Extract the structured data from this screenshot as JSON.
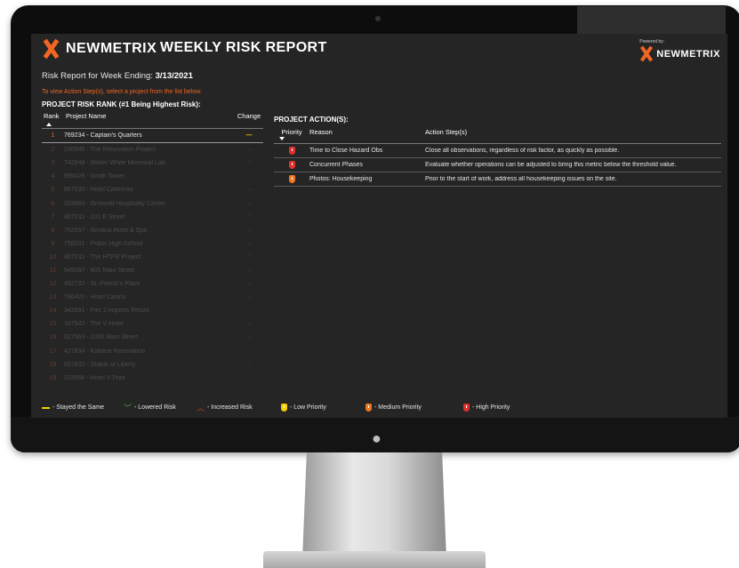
{
  "header": {
    "brand": "NEWMETRIX",
    "title": "WEEKLY RISK REPORT",
    "powered_by_label": "Powered by:",
    "powered_by_brand": "NEWMETRIX"
  },
  "week": {
    "label": "Risk Report for Week Ending:",
    "date": "3/13/2021"
  },
  "instruction": "To view Action Step(s), select a project from the list below:",
  "rank_section": {
    "title": "PROJECT RISK RANK (#1 Being Highest Risk):",
    "columns": {
      "rank": "Rank",
      "project": "Project Name",
      "change": "Change"
    },
    "rows": [
      {
        "rank": "1",
        "project": "769234 - Captain's Quarters",
        "change": "same",
        "glyph": "—",
        "selected": true
      },
      {
        "rank": "2",
        "project": "230945 - The Renovation Project",
        "change": "same",
        "glyph": "—"
      },
      {
        "rank": "3",
        "project": "742948 - Walter White Memorial Lab",
        "change": "lower",
        "glyph": "﹀"
      },
      {
        "rank": "4",
        "project": "985428 - Smith Tower",
        "change": "higher",
        "glyph": "︿"
      },
      {
        "rank": "5",
        "project": "867530 - Hotel California",
        "change": "same",
        "glyph": "—"
      },
      {
        "rank": "6",
        "project": "329864 - Griswold Hospitality Center",
        "change": "same",
        "glyph": "—"
      },
      {
        "rank": "7",
        "project": "867531 - 101 E Street",
        "change": "lower",
        "glyph": "﹀"
      },
      {
        "rank": "8",
        "project": "762957 - Nirvana Hotel & Spa",
        "change": "same",
        "glyph": "—"
      },
      {
        "rank": "9",
        "project": "758201 - Public High School",
        "change": "same",
        "glyph": "—"
      },
      {
        "rank": "10",
        "project": "867531 - The HTPR Project",
        "change": "lower",
        "glyph": "﹀"
      },
      {
        "rank": "11",
        "project": "549287 - 805 Main Street",
        "change": "same",
        "glyph": "—"
      },
      {
        "rank": "12",
        "project": "492732 - St. Patrick's Place",
        "change": "same",
        "glyph": "—"
      },
      {
        "rank": "13",
        "project": "786420 - Hotel Casino",
        "change": "same",
        "glyph": "—"
      },
      {
        "rank": "14",
        "project": "342691 - Pier 2 Imports Resort",
        "change": "higher",
        "glyph": "︿"
      },
      {
        "rank": "15",
        "project": "187542 - The V Hotel",
        "change": "same",
        "glyph": "—"
      },
      {
        "rank": "16",
        "project": "627563 - 1000 Main Street",
        "change": "same",
        "glyph": "—"
      },
      {
        "rank": "17",
        "project": "427834 - Kobane Renovation",
        "change": "higher",
        "glyph": "︿"
      },
      {
        "rank": "18",
        "project": "657832 - Statue of Liberty",
        "change": "same",
        "glyph": "—"
      },
      {
        "rank": "19",
        "project": "319856 - Hotel V Pool",
        "change": "higher",
        "glyph": "︿"
      }
    ]
  },
  "action_section": {
    "title": "PROJECT ACTION(S):",
    "columns": {
      "priority": "Priority",
      "reason": "Reason",
      "steps": "Action Step(s)"
    },
    "rows": [
      {
        "priority": "high",
        "reason": "Time to Close Hazard Obs",
        "step": "Close all observations, regardless of risk factor, as quickly as possible."
      },
      {
        "priority": "high",
        "reason": "Concurrent Phases",
        "step": "Evaluate whether operations can be adjusted to bring this metric below the threshold value."
      },
      {
        "priority": "medium",
        "reason": "Photos: Housekeeping",
        "step": "Prior to the start of work, address all housekeeping issues on the site."
      }
    ]
  },
  "legend": {
    "same": "- Stayed the Same",
    "lower": "- Lowered Risk",
    "higher": "- Increased Risk",
    "low": "- Low Priority",
    "medium": "- Medium Priority",
    "high": "- High Priority"
  },
  "colors": {
    "accent": "#f26522",
    "same": "#f5d000",
    "lower": "#3cb43c",
    "higher": "#e03030",
    "high_priority": "#e03030",
    "medium_priority": "#f07a20",
    "low_priority": "#f5d000"
  }
}
